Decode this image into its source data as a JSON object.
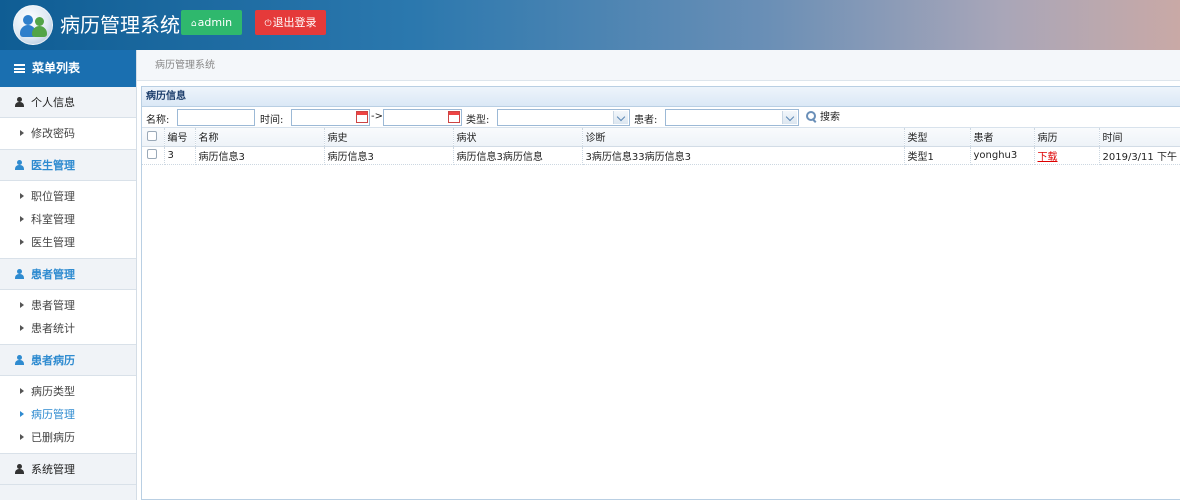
{
  "header": {
    "title": "病历管理系统",
    "user_label": "admin",
    "logout_label": "退出登录",
    "colors": {
      "admin_btn": "#2fb86d",
      "logout_btn": "#e53a3a"
    }
  },
  "sidebar": {
    "heading": "菜单列表",
    "groups": [
      {
        "label": "个人信息",
        "items": [
          "修改密码"
        ]
      },
      {
        "label": "医生管理",
        "items": [
          "职位管理",
          "科室管理",
          "医生管理"
        ]
      },
      {
        "label": "患者管理",
        "items": [
          "患者管理",
          "患者统计"
        ]
      },
      {
        "label": "患者病历",
        "items": [
          "病历类型",
          "病历管理",
          "已删病历"
        ],
        "active_item": "病历管理"
      },
      {
        "label": "系统管理",
        "items": []
      }
    ]
  },
  "breadcrumb": "病历管理系统",
  "panel": {
    "title": "病历信息",
    "filters": {
      "name_label": "名称:",
      "time_label": "时间:",
      "range_sep": "->",
      "type_label": "类型:",
      "patient_label": "患者:",
      "search_label": "搜索"
    },
    "table": {
      "columns": [
        "编号",
        "名称",
        "病史",
        "病状",
        "诊断",
        "类型",
        "患者",
        "病历",
        "时间"
      ],
      "rows": [
        [
          "3",
          "病历信息3",
          "病历信息3",
          "病历信息3病历信息",
          "3病历信息33病历信息3",
          "类型1",
          "yonghu3",
          "下载",
          "2019/3/11 下午"
        ]
      ]
    }
  }
}
